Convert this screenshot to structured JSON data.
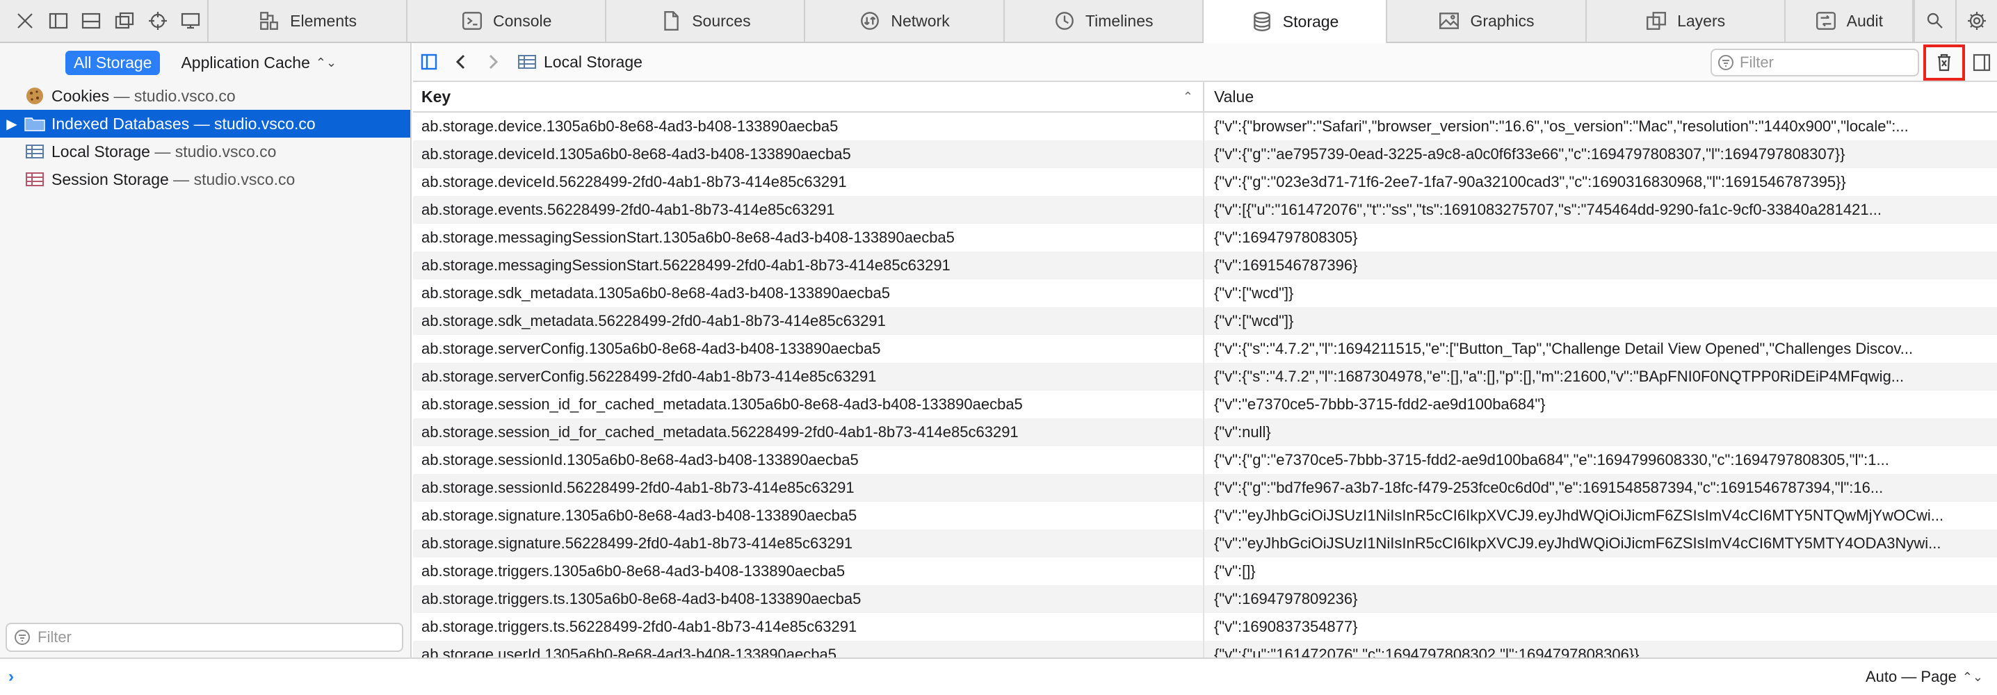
{
  "tabs": [
    {
      "label": "Elements",
      "icon": "elements-icon",
      "active": false
    },
    {
      "label": "Console",
      "icon": "console-icon",
      "active": false
    },
    {
      "label": "Sources",
      "icon": "sources-icon",
      "active": false
    },
    {
      "label": "Network",
      "icon": "network-icon",
      "active": false
    },
    {
      "label": "Timelines",
      "icon": "timelines-icon",
      "active": false
    },
    {
      "label": "Storage",
      "icon": "storage-icon",
      "active": true
    },
    {
      "label": "Graphics",
      "icon": "graphics-icon",
      "active": false
    },
    {
      "label": "Layers",
      "icon": "layers-icon",
      "active": false
    },
    {
      "label": "Audit",
      "icon": "audit-icon",
      "active": false
    }
  ],
  "sidebar": {
    "scope": {
      "all_label": "All Storage",
      "cache_label": "Application Cache"
    },
    "items": [
      {
        "name": "Cookies",
        "domain": "studio.vsco.co"
      },
      {
        "name": "Indexed Databases",
        "domain": "studio.vsco.co"
      },
      {
        "name": "Local Storage",
        "domain": "studio.vsco.co"
      },
      {
        "name": "Session Storage",
        "domain": "studio.vsco.co"
      }
    ],
    "filter_placeholder": "Filter",
    "separator": "—"
  },
  "content": {
    "breadcrumb": "Local Storage",
    "filter_placeholder": "Filter",
    "columns": {
      "key": "Key",
      "value": "Value"
    },
    "rows": [
      {
        "key": "ab.storage.device.1305a6b0-8e68-4ad3-b408-133890aecba5",
        "value": "{\"v\":{\"browser\":\"Safari\",\"browser_version\":\"16.6\",\"os_version\":\"Mac\",\"resolution\":\"1440x900\",\"locale\":..."
      },
      {
        "key": "ab.storage.deviceId.1305a6b0-8e68-4ad3-b408-133890aecba5",
        "value": "{\"v\":{\"g\":\"ae795739-0ead-3225-a9c8-a0c0f6f33e66\",\"c\":1694797808307,\"l\":1694797808307}}"
      },
      {
        "key": "ab.storage.deviceId.56228499-2fd0-4ab1-8b73-414e85c63291",
        "value": "{\"v\":{\"g\":\"023e3d71-71f6-2ee7-1fa7-90a32100cad3\",\"c\":1690316830968,\"l\":1691546787395}}"
      },
      {
        "key": "ab.storage.events.56228499-2fd0-4ab1-8b73-414e85c63291",
        "value": "{\"v\":[{\"u\":\"161472076\",\"t\":\"ss\",\"ts\":1691083275707,\"s\":\"745464dd-9290-fa1c-9cf0-33840a281421..."
      },
      {
        "key": "ab.storage.messagingSessionStart.1305a6b0-8e68-4ad3-b408-133890aecba5",
        "value": "{\"v\":1694797808305}"
      },
      {
        "key": "ab.storage.messagingSessionStart.56228499-2fd0-4ab1-8b73-414e85c63291",
        "value": "{\"v\":1691546787396}"
      },
      {
        "key": "ab.storage.sdk_metadata.1305a6b0-8e68-4ad3-b408-133890aecba5",
        "value": "{\"v\":[\"wcd\"]}"
      },
      {
        "key": "ab.storage.sdk_metadata.56228499-2fd0-4ab1-8b73-414e85c63291",
        "value": "{\"v\":[\"wcd\"]}"
      },
      {
        "key": "ab.storage.serverConfig.1305a6b0-8e68-4ad3-b408-133890aecba5",
        "value": "{\"v\":{\"s\":\"4.7.2\",\"l\":1694211515,\"e\":[\"Button_Tap\",\"Challenge Detail View Opened\",\"Challenges Discov..."
      },
      {
        "key": "ab.storage.serverConfig.56228499-2fd0-4ab1-8b73-414e85c63291",
        "value": "{\"v\":{\"s\":\"4.7.2\",\"l\":1687304978,\"e\":[],\"a\":[],\"p\":[],\"m\":21600,\"v\":\"BApFNI0F0NQTPP0RiDEiP4MFqwig..."
      },
      {
        "key": "ab.storage.session_id_for_cached_metadata.1305a6b0-8e68-4ad3-b408-133890aecba5",
        "value": "{\"v\":\"e7370ce5-7bbb-3715-fdd2-ae9d100ba684\"}"
      },
      {
        "key": "ab.storage.session_id_for_cached_metadata.56228499-2fd0-4ab1-8b73-414e85c63291",
        "value": "{\"v\":null}"
      },
      {
        "key": "ab.storage.sessionId.1305a6b0-8e68-4ad3-b408-133890aecba5",
        "value": "{\"v\":{\"g\":\"e7370ce5-7bbb-3715-fdd2-ae9d100ba684\",\"e\":1694799608330,\"c\":1694797808305,\"l\":1..."
      },
      {
        "key": "ab.storage.sessionId.56228499-2fd0-4ab1-8b73-414e85c63291",
        "value": "{\"v\":{\"g\":\"bd7fe967-a3b7-18fc-f479-253fce0c6d0d\",\"e\":1691548587394,\"c\":1691546787394,\"l\":16..."
      },
      {
        "key": "ab.storage.signature.1305a6b0-8e68-4ad3-b408-133890aecba5",
        "value": "{\"v\":\"eyJhbGciOiJSUzI1NiIsInR5cCI6IkpXVCJ9.eyJhdWQiOiJicmF6ZSIsImV4cCI6MTY5NTQwMjYwOCwi..."
      },
      {
        "key": "ab.storage.signature.56228499-2fd0-4ab1-8b73-414e85c63291",
        "value": "{\"v\":\"eyJhbGciOiJSUzI1NiIsInR5cCI6IkpXVCJ9.eyJhdWQiOiJicmF6ZSIsImV4cCI6MTY5MTY4ODA3Nywi..."
      },
      {
        "key": "ab.storage.triggers.1305a6b0-8e68-4ad3-b408-133890aecba5",
        "value": "{\"v\":[]}"
      },
      {
        "key": "ab.storage.triggers.ts.1305a6b0-8e68-4ad3-b408-133890aecba5",
        "value": "{\"v\":1694797809236}"
      },
      {
        "key": "ab.storage.triggers.ts.56228499-2fd0-4ab1-8b73-414e85c63291",
        "value": "{\"v\":1690837354877}"
      },
      {
        "key": "ab.storage.userId.1305a6b0-8e68-4ad3-b408-133890aecba5",
        "value": "{\"v\":{\"u\":\"161472076\",\"c\":1694797808302,\"l\":1694797808306}}"
      }
    ]
  },
  "console": {
    "context_label": "Auto — Page"
  },
  "colors": {
    "accent": "#0a64d8",
    "scope_active": "#2a7ef6",
    "highlight": "#e8231b"
  }
}
